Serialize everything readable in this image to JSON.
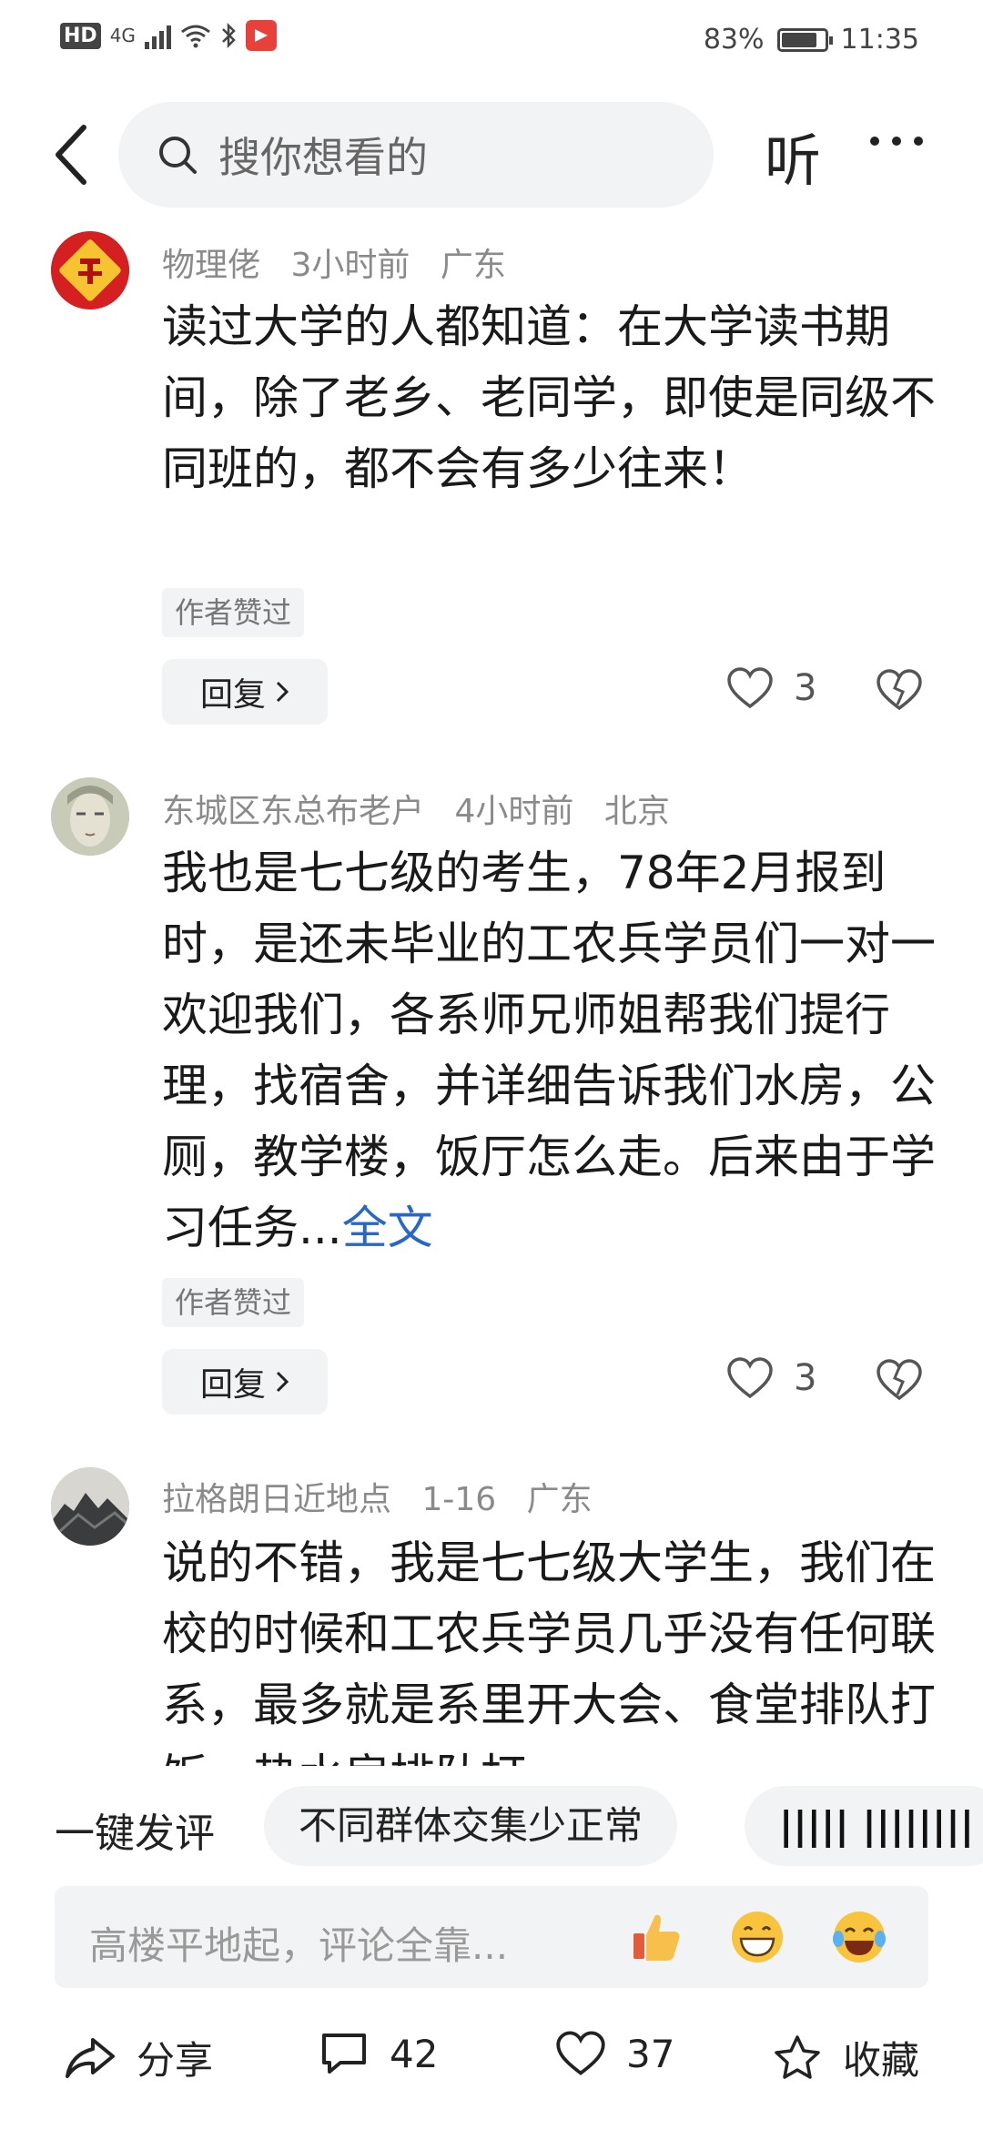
{
  "status_bar": {
    "hd": "HD",
    "network": "4G",
    "battery_percent": "83%",
    "battery_level": 0.83,
    "time": "11:35"
  },
  "header": {
    "search_placeholder": "搜你想看的",
    "listen_label": "听"
  },
  "comments": [
    {
      "user": "物理佬",
      "time": "3小时前",
      "location": "广东",
      "text": "读过大学的人都知道：在大学读书期间，除了老乡、老同学，即使是同级不同班的，都不会有多少往来！",
      "tag": "作者赞过",
      "reply_label": "回复",
      "likes": "3"
    },
    {
      "user": "东城区东总布老户",
      "time": "4小时前",
      "location": "北京",
      "text": "我也是七七级的考生，78年2月报到时，是还未毕业的工农兵学员们一对一欢迎我们，各系师兄师姐帮我们提行理，找宿舍，并详细告诉我们水房，公厕，教学楼，饭厅怎么走。后来由于学习任务...",
      "more_label": "全文",
      "tag": "作者赞过",
      "reply_label": "回复",
      "likes": "3"
    },
    {
      "user": "拉格朗日近地点",
      "time": "1-16",
      "location": "广东",
      "text": "说的不错，我是七七级大学生，我们在校的时候和工农兵学员几乎没有任何联系，最多就是系里开大会、食堂排队打饭、热水房排队打"
    }
  ],
  "quick_comment": {
    "label": "一键发评",
    "chips": [
      "不同群体交集少正常",
      "||||| ||||||||"
    ]
  },
  "input": {
    "placeholder": "高楼平地起，评论全靠..."
  },
  "bottom_bar": {
    "share_label": "分享",
    "comment_count": "42",
    "like_count": "37",
    "favorite_label": "收藏"
  },
  "colors": {
    "link": "#2867c7",
    "chip_bg": "#f2f3f5",
    "meta": "#8a8a8a"
  }
}
